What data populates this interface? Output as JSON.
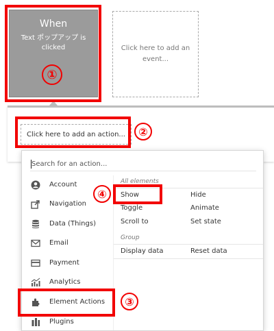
{
  "event": {
    "title": "When",
    "description": "Text ポップアップ is clicked",
    "add_event_text": "Click here to add an event..."
  },
  "actions": {
    "add_action_text": "Click here to add an action..."
  },
  "menu": {
    "search_placeholder": "Search for an action...",
    "categories": [
      {
        "label": "Account",
        "icon": "account-icon"
      },
      {
        "label": "Navigation",
        "icon": "navigation-icon"
      },
      {
        "label": "Data (Things)",
        "icon": "database-icon"
      },
      {
        "label": "Email",
        "icon": "email-icon"
      },
      {
        "label": "Payment",
        "icon": "payment-icon"
      },
      {
        "label": "Analytics",
        "icon": "analytics-icon"
      },
      {
        "label": "Element Actions",
        "icon": "element-actions-icon"
      },
      {
        "label": "Plugins",
        "icon": "plugins-icon"
      }
    ],
    "groups": [
      {
        "title": "All elements",
        "items": [
          "Show",
          "Hide",
          "Toggle",
          "Animate",
          "Scroll to",
          "Set state"
        ]
      },
      {
        "title": "Group",
        "items": [
          "Display data",
          "Reset data"
        ]
      }
    ]
  },
  "annotations": {
    "badge1": "①",
    "badge2": "②",
    "badge3": "③",
    "badge4": "④"
  },
  "colors": {
    "highlight": "#f20000",
    "event_card": "#9b9b9b"
  }
}
